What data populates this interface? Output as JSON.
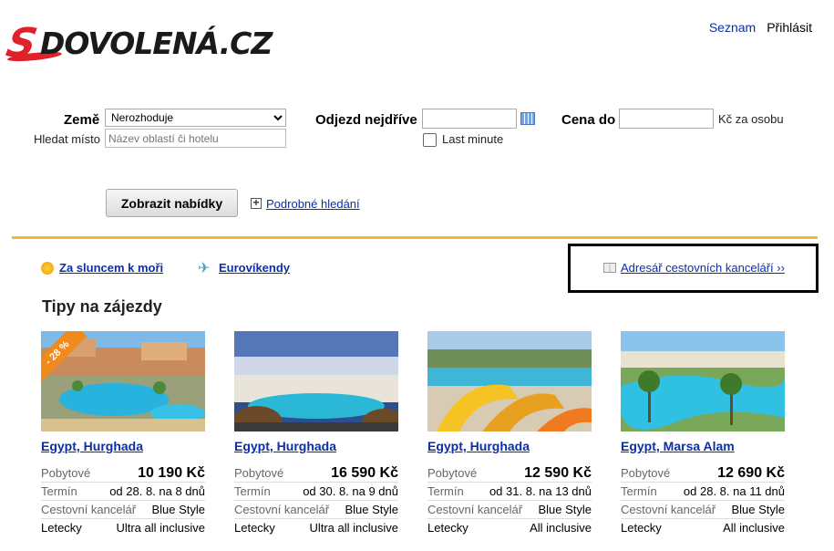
{
  "brand": {
    "logo_s": "S",
    "logo_rest": "DOVOLENÁ.CZ"
  },
  "toplinks": {
    "seznam": "Seznam",
    "login": "Přihlásit"
  },
  "search": {
    "country_label": "Země",
    "country_value": "Nerozhoduje",
    "place_label": "Hledat místo",
    "place_placeholder": "Název oblastí či hotelu",
    "departure_label": "Odjezd nejdříve",
    "last_minute_label": "Last minute",
    "price_label": "Cena do",
    "price_unit": "Kč za osobu",
    "submit_label": "Zobrazit nabídky",
    "advanced_label": "Podrobné hledání",
    "plus": "+"
  },
  "nav": {
    "sea_label": "Za sluncem k moři",
    "weekend_label": "Eurovíkendy",
    "plane_glyph": "✈",
    "directory_label": "Adresář cestovních kanceláří ››"
  },
  "tips": {
    "heading": "Tipy na zájezdy",
    "cards": [
      {
        "discount": "- 28 %",
        "dest": "Egypt, Hurghada",
        "type": "Pobytové",
        "price": "10 190 Kč",
        "term_label": "Termín",
        "term": "od 28. 8. na 8 dnů",
        "agency_label": "Cestovní kancelář",
        "agency": "Blue Style",
        "transport": "Letecky",
        "board": "Ultra all inclusive"
      },
      {
        "dest": "Egypt, Hurghada",
        "type": "Pobytové",
        "price": "16 590 Kč",
        "term_label": "Termín",
        "term": "od 30. 8. na 9 dnů",
        "agency_label": "Cestovní kancelář",
        "agency": "Blue Style",
        "transport": "Letecky",
        "board": "Ultra all inclusive"
      },
      {
        "dest": "Egypt, Hurghada",
        "type": "Pobytové",
        "price": "12 590 Kč",
        "term_label": "Termín",
        "term": "od 31. 8. na 13 dnů",
        "agency_label": "Cestovní kancelář",
        "agency": "Blue Style",
        "transport": "Letecky",
        "board": "All inclusive"
      },
      {
        "dest": "Egypt, Marsa Alam",
        "type": "Pobytové",
        "price": "12 690 Kč",
        "term_label": "Termín",
        "term": "od 28. 8. na 11 dnů",
        "agency_label": "Cestovní kancelář",
        "agency": "Blue Style",
        "transport": "Letecky",
        "board": "All inclusive"
      }
    ]
  },
  "colors": {
    "accent": "#f4b92a",
    "link": "#0a2fa8",
    "brand_red": "#e0202a"
  }
}
